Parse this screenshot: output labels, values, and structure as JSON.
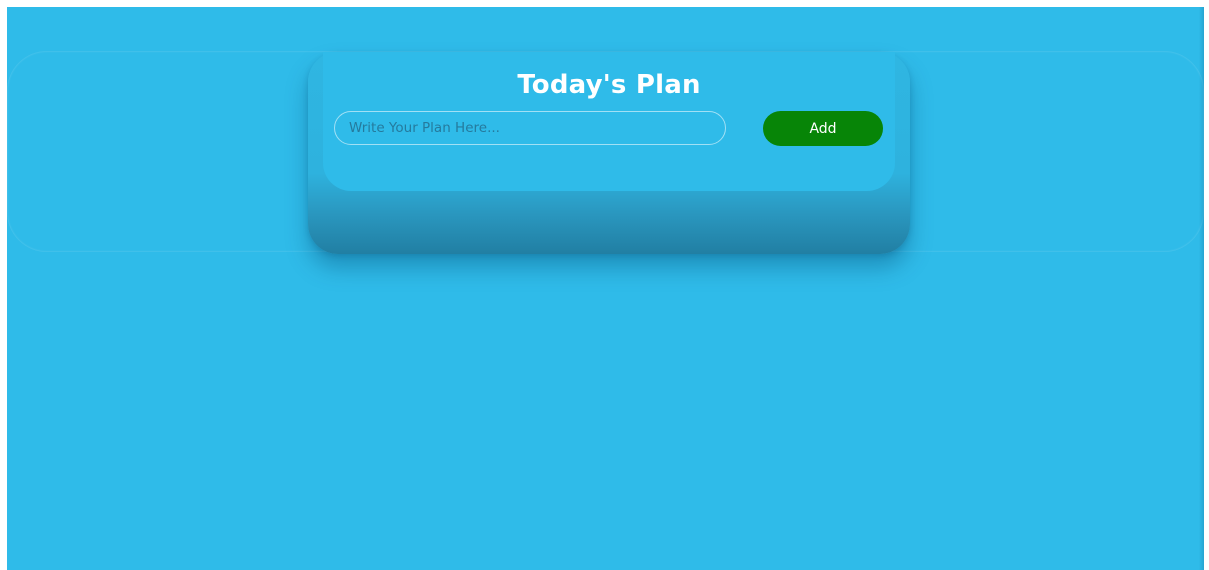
{
  "app": {
    "background_color": "#2fbbe9"
  },
  "card": {
    "title": "Today's Plan",
    "input": {
      "placeholder": "Write Your Plan Here...",
      "value": ""
    },
    "add_button": {
      "label": "Add",
      "color": "#078507"
    }
  }
}
